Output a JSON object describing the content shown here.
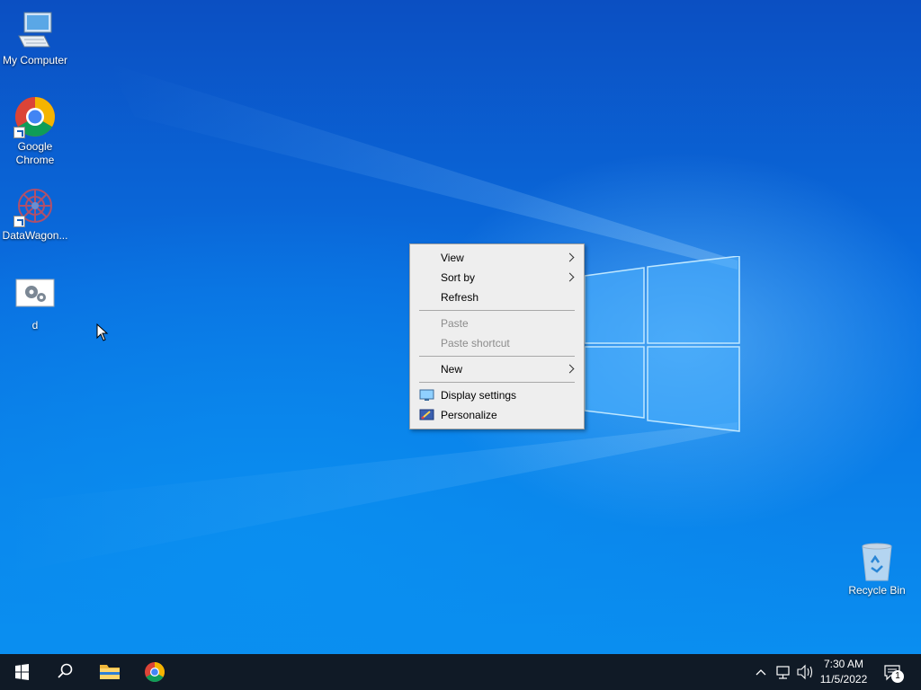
{
  "desktop": {
    "icons": [
      {
        "label": "My Computer",
        "icon": "computer-icon"
      },
      {
        "label": "Google Chrome",
        "icon": "chrome-icon"
      },
      {
        "label": "DataWagon...",
        "icon": "datawagon-icon"
      },
      {
        "label": "d",
        "icon": "settings-file-icon"
      },
      {
        "label": "Recycle Bin",
        "icon": "recycle-bin-icon"
      }
    ]
  },
  "context_menu": {
    "items": [
      {
        "label": "View",
        "enabled": true,
        "submenu": true
      },
      {
        "label": "Sort by",
        "enabled": true,
        "submenu": true
      },
      {
        "label": "Refresh",
        "enabled": true,
        "submenu": false
      },
      {
        "label": "Paste",
        "enabled": false,
        "submenu": false
      },
      {
        "label": "Paste shortcut",
        "enabled": false,
        "submenu": false
      },
      {
        "label": "New",
        "enabled": true,
        "submenu": true
      },
      {
        "label": "Display settings",
        "enabled": true,
        "submenu": false,
        "icon": "display-icon"
      },
      {
        "label": "Personalize",
        "enabled": true,
        "submenu": false,
        "icon": "personalize-icon"
      }
    ]
  },
  "taskbar": {
    "pinned": [
      "start-icon",
      "search-icon",
      "file-explorer-icon",
      "chrome-icon"
    ],
    "tray": [
      "chevron-up-icon",
      "network-icon",
      "volume-icon"
    ],
    "time": "7:30 AM",
    "date": "11/5/2022",
    "notification_count": "1"
  },
  "colors": {
    "taskbar_bg": "#101a26",
    "menu_bg": "#eeeeee",
    "desktop_blue": "#0a6fe0"
  }
}
